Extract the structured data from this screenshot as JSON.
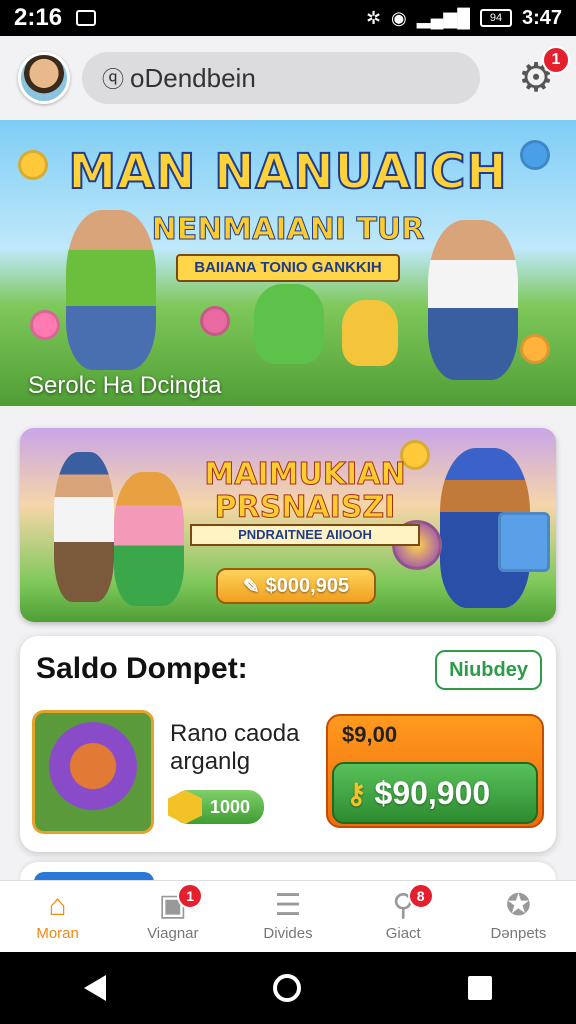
{
  "status_bar": {
    "time": "2:16",
    "right_text": "3:47",
    "battery": "94"
  },
  "header": {
    "search_text": "oDendbein",
    "settings_badge": "1"
  },
  "hero": {
    "title": "MAN NANUAICH",
    "subtitle": "NENMAIANI TUR",
    "ribbon": "BAIIANA TONIO GANKKIH",
    "caption": "Serolc Ha Dcingta"
  },
  "promo": {
    "title": "MAIMUKIAN PRSNAISZI",
    "ribbon": "PNDRAITNEE AIIOOH",
    "button": "$000,905"
  },
  "wallet": {
    "title": "Saldo Dompet:",
    "chip": "Niubdey",
    "game_name": "Rano caoda arganlg",
    "coins": "1000",
    "price_small": "$9,00",
    "price_main": "$90,900"
  },
  "nav": [
    {
      "label": "Moran",
      "icon": "home-icon",
      "badge": ""
    },
    {
      "label": "Viagnar",
      "icon": "puzzle-icon",
      "badge": "1"
    },
    {
      "label": "Divides",
      "icon": "list-icon",
      "badge": ""
    },
    {
      "label": "Giact",
      "icon": "search-icon",
      "badge": "8"
    },
    {
      "label": "Dənpets",
      "icon": "star-badge-icon",
      "badge": ""
    }
  ],
  "colors": {
    "accent": "#f28a10",
    "badge": "#e5202e",
    "wallet_green": "#2e9b48"
  }
}
